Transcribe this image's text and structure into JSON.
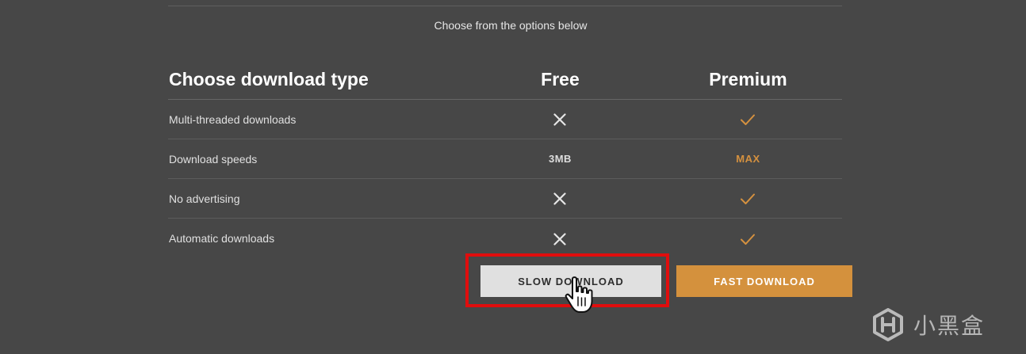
{
  "subtitle": "Choose from the options below",
  "table": {
    "header": {
      "label": "Choose download type",
      "free": "Free",
      "premium": "Premium"
    },
    "rows": [
      {
        "label": "Multi-threaded downloads",
        "free_icon": "cross-icon",
        "premium_icon": "check-icon"
      },
      {
        "label": "Download speeds",
        "free": "3MB",
        "premium": "MAX"
      },
      {
        "label": "No advertising",
        "free_icon": "cross-icon",
        "premium_icon": "check-icon"
      },
      {
        "label": "Automatic downloads",
        "free_icon": "cross-icon",
        "premium_icon": "check-icon"
      }
    ]
  },
  "buttons": {
    "slow": "SLOW DOWNLOAD",
    "fast": "FAST DOWNLOAD"
  },
  "watermark": {
    "text": "小黑盒",
    "icon": "heybox-logo-icon"
  },
  "colors": {
    "background": "#474747",
    "accent": "#d4913d",
    "highlight": "#e00d0d",
    "slow_button_bg": "#e0e0e0"
  },
  "cursor": {
    "icon": "hand-pointer-icon"
  }
}
